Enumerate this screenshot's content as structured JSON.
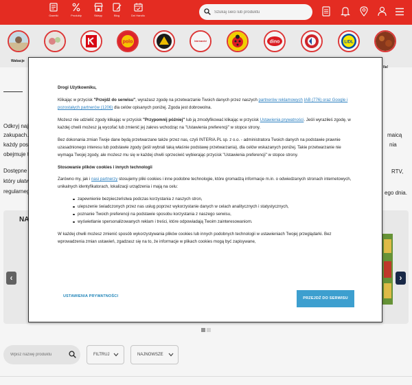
{
  "header": {
    "nav": [
      {
        "label": "Gazetki",
        "icon": "newspaper-icon"
      },
      {
        "label": "Produkty",
        "icon": "percent-icon"
      },
      {
        "label": "Sklepy",
        "icon": "store-icon"
      },
      {
        "label": "Blog",
        "icon": "blog-icon"
      },
      {
        "label": "Dni Handlu",
        "icon": "calendar-icon"
      }
    ],
    "search_placeholder": "Szukaj sieci lub produktu",
    "right_icons": [
      "list-icon",
      "bell-icon",
      "location-pin-icon",
      "user-icon",
      "hamburger-menu-icon"
    ]
  },
  "stores": {
    "labels": [
      "Wakacje",
      "lla!"
    ],
    "logos": [
      "kaufland",
      "polo",
      "chata",
      "intermarche",
      "biedronka",
      "dino",
      "carrefour",
      "lidl"
    ],
    "logo_text": {
      "polo": "polo",
      "dino": "dino",
      "lidl": "LIDL",
      "intermarche": "Intermarché"
    }
  },
  "background": {
    "line1_left": "Odkryj naj",
    "line2_left": "zakupach.",
    "line2_right": "maicą",
    "line3_left": "każdy posi",
    "line3_right": "nia",
    "line4_left": "obejmuje t",
    "line5_left": "Dostępne s",
    "line5_right": "RTV,",
    "line6_left": "który ułatw",
    "line7_left": "regularneg",
    "line7_right": "ego dnia.",
    "carousel_heading": "NA"
  },
  "modal": {
    "greeting": "Drogi Użytkowniku,",
    "p1_a": "Klikając w przycisk ",
    "p1_b": "\"Przejdź do serwisu\"",
    "p1_c": ", wyrażasz zgodę na przetwarzanie Twoich danych przez naszych ",
    "p1_link1": "partnerów reklamowych",
    "p1_link2": "IAB (776) oraz Google i pozostałych partnerów (1206)",
    "p1_d": " dla celów opisanych poniżej. Zgoda jest dobrowolna.",
    "p2_a": "Możesz nie udzielić zgody klikając w przycisk ",
    "p2_b": "\"Przypomnij później\"",
    "p2_c": " lub ją zmodyfikować klikając w przycisk ",
    "p2_link": "Ustawienia prywatności",
    "p2_d": ". Jeśli wyraziłeś zgodę, w każdej chwili możesz ją wycofać lub zmienić jej zakres wchodząc na \"Ustawienia preferencji\" w stopce strony.",
    "p3": "Bez dokonania zmian Twoje dane będą przetwarzane także przez nas, czyli INTERIA.PL sp. z o.o. - administratora Twoich danych na podstawie prawnie uzasadnionego interesu lub podstawie zgody (jeśli wybrali taką właśnie podstawę przetwarzania), dla celów wskazanych poniżej. Takie przetwarzanie nie wymaga Twojej zgody, ale możesz mu się w każdej chwili sprzeciwić wybierając przycisk \"Ustawienia preferencji\" w stopce strony.",
    "section_title": "Stosowanie plików cookies i innych technologii",
    "p4_a": "Zarówno my, jak i ",
    "p4_link": "nasi partnerzy",
    "p4_b": " stosujemy pliki cookies i inne podobne technologie, które gromadzą informacje m.in. o odwiedzanych stronach internetowych, unikalnych identyfikatorach, lokalizacji urządzenia i mają na celu:",
    "bullets": [
      "zapewnienie bezpieczeństwa podczas korzystania z naszych stron,",
      "ulepszenie świadczonych przez nas usług poprzez wykorzystanie danych w celach analitycznych i statystycznych,",
      "poznanie Twoich preferencji na podstawie sposobu korzystania z naszego serwisu,",
      "wyświetlanie spersonalizowanych reklam i treści, które odpowiadają Twoim zainteresowaniom."
    ],
    "p5": "W każdej chwili możesz zmienić sposób wykorzystywania plików cookies lub innych podobnych technologii w ustawieniach Twojej przeglądarki. Bez wprowadzenia zmian ustawień, zgadzasz się na to, że informacje w plikach cookies mogą być zapisywane,",
    "btn_settings": "USTAWIENIA PRYWATNOŚCI",
    "btn_accept": "PRZEJDŹ DO SERWISU"
  },
  "filters": {
    "search_placeholder": "Wpisz nazwę produktu",
    "filter_label": "FILTRUJ",
    "sort_label": "NAJNOWSZE"
  },
  "colors": {
    "brand_red": "#ee2e24",
    "accent_blue": "#3d9fcf",
    "link_blue": "#2a7fc0",
    "arrow_dark": "#666666",
    "arrow_navy": "#1b2b4a"
  }
}
